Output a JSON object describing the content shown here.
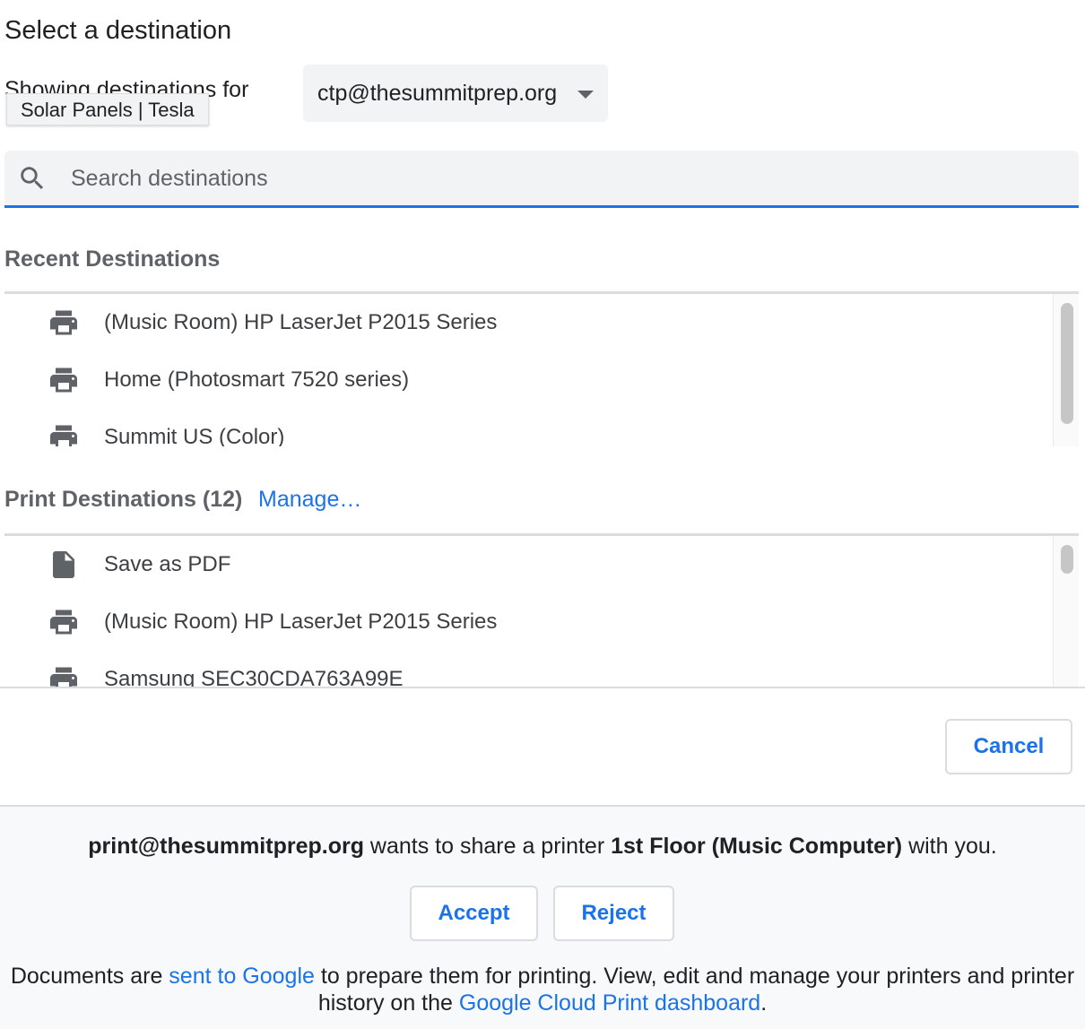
{
  "dialog": {
    "title": "Select a destination",
    "showing_label": "Showing destinations for",
    "tooltip": "Solar Panels | Tesla",
    "account": "ctp@thesummitprep.org"
  },
  "search": {
    "placeholder": "Search destinations",
    "value": ""
  },
  "recent": {
    "heading": "Recent Destinations",
    "items": [
      {
        "label": "(Music Room) HP LaserJet P2015 Series",
        "icon": "printer-icon"
      },
      {
        "label": "Home (Photosmart 7520 series)",
        "icon": "printer-icon"
      },
      {
        "label": "Summit US (Color)",
        "icon": "printer-icon"
      }
    ]
  },
  "print_destinations": {
    "heading": "Print Destinations",
    "count": "(12)",
    "manage_label": "Manage…",
    "items": [
      {
        "label": "Save as PDF",
        "icon": "document-icon"
      },
      {
        "label": "(Music Room) HP LaserJet P2015 Series",
        "icon": "printer-icon"
      },
      {
        "label": "Samsung SEC30CDA763A99E",
        "icon": "printer-icon"
      }
    ]
  },
  "actions": {
    "cancel_label": "Cancel"
  },
  "share": {
    "sender": "print@thesummitprep.org",
    "text_middle": " wants to share a printer ",
    "printer_name": "1st Floor (Music Computer)",
    "text_end": " with you.",
    "accept_label": "Accept",
    "reject_label": "Reject"
  },
  "footer": {
    "part1": "Documents are ",
    "link1": "sent to Google",
    "part2": " to prepare them for printing. View, edit and manage your printers and printer history on the ",
    "link2": "Google Cloud Print dashboard",
    "part3": "."
  },
  "colors": {
    "accent": "#1a73e8",
    "icon_gray": "#5f6368",
    "field_bg": "#f1f3f4"
  }
}
